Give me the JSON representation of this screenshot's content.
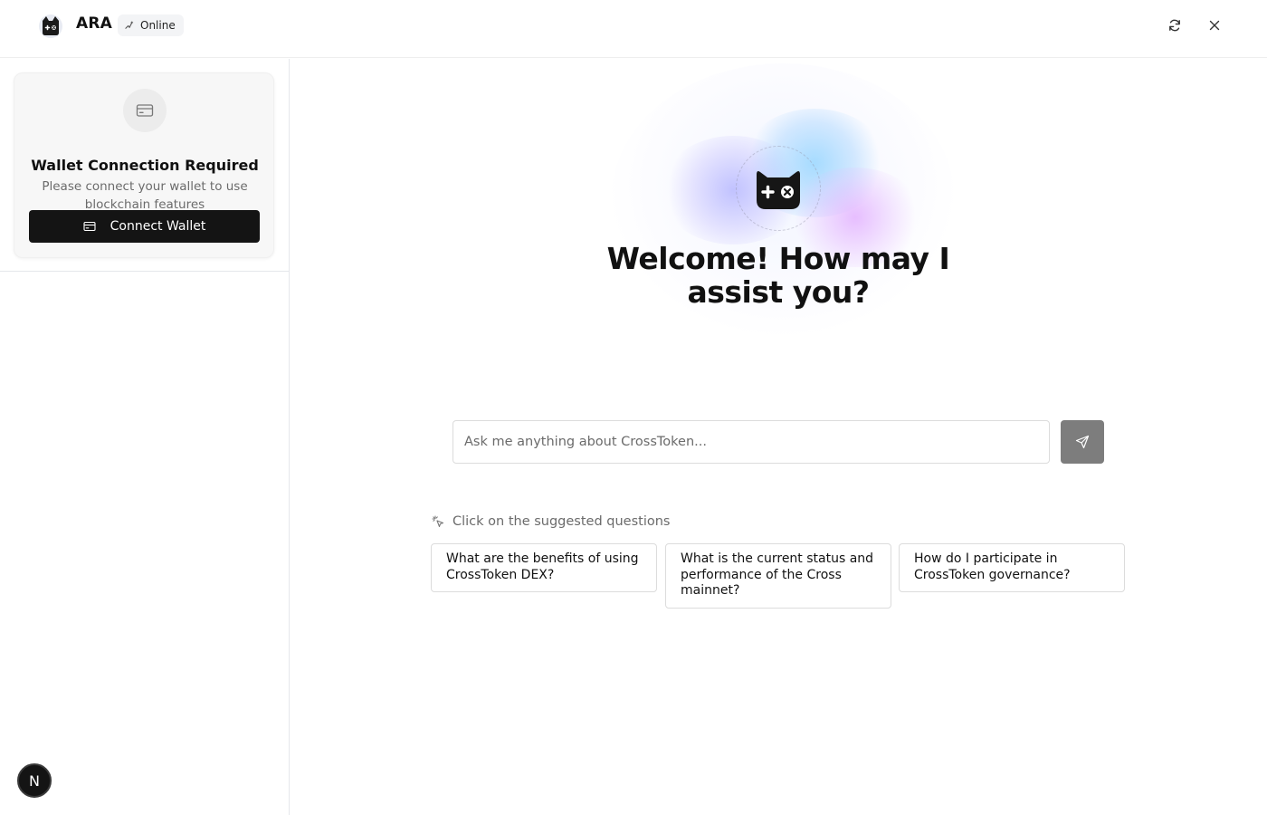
{
  "header": {
    "app_name": "ARA",
    "status": "Online"
  },
  "sidebar": {
    "wallet_card": {
      "title": "Wallet Connection Required",
      "description": "Please connect your wallet to use blockchain features",
      "button_label": "Connect Wallet"
    },
    "avatar_initial": "N"
  },
  "main": {
    "welcome_line1": "Welcome! How may I",
    "welcome_line2": "assist you?",
    "input_placeholder": "Ask me anything about CrossToken...",
    "input_value": "",
    "suggestions_label": "Click on the suggested questions",
    "suggestions": [
      "What are the benefits of using CrossToken DEX?",
      "What is the current status and performance of the Cross mainnet?",
      "How do I participate in CrossToken governance?"
    ]
  },
  "colors": {
    "primary_button": "#141414",
    "send_button": "#7d7d7d",
    "muted_text": "#6b6b6b",
    "border": "#dcdcdc"
  }
}
